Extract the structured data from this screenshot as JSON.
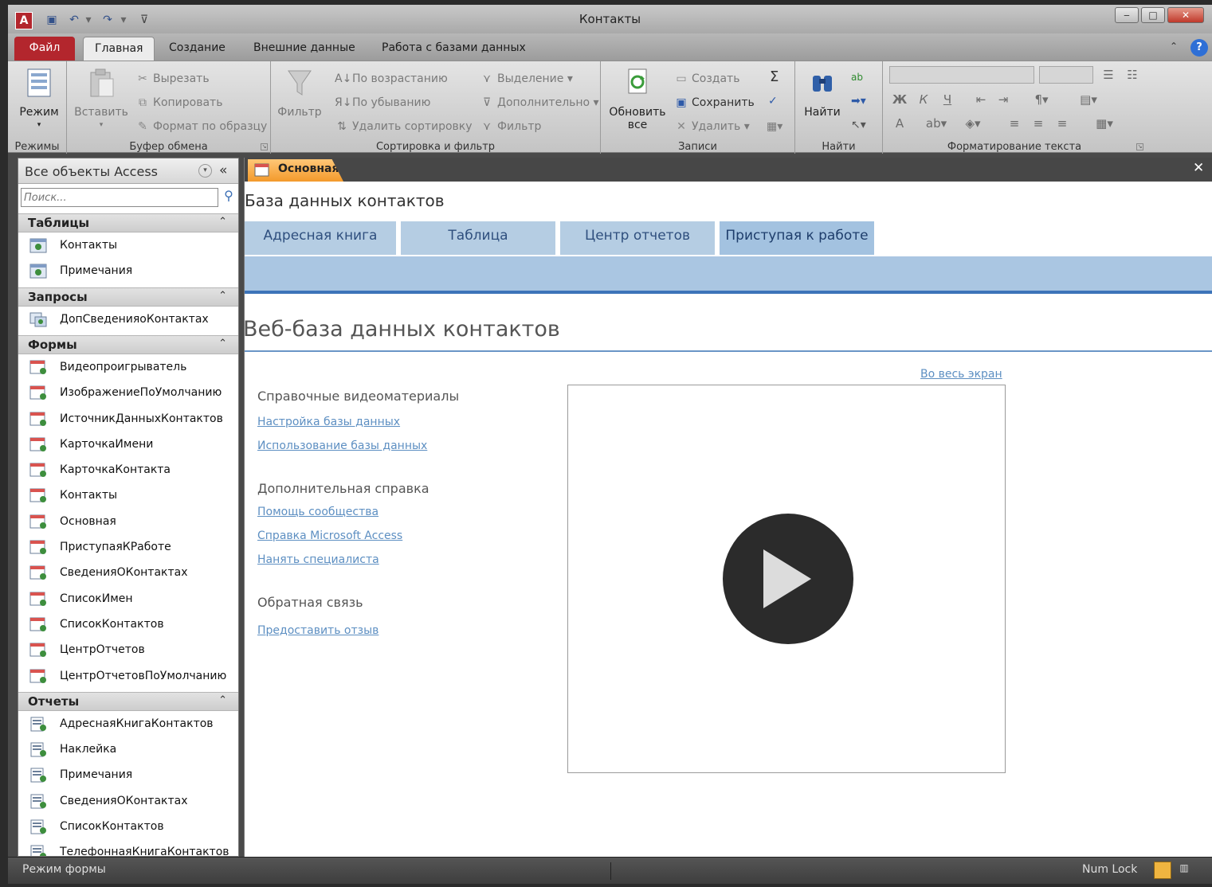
{
  "window": {
    "title": "Контакты",
    "app_icon_letter": "A"
  },
  "ribbon_tabs": [
    "Файл",
    "Главная",
    "Создание",
    "Внешние данные",
    "Работа с базами данных"
  ],
  "ribbon": {
    "views": {
      "mode": "Режим",
      "label": "Режимы"
    },
    "clipboard": {
      "paste": "Вставить",
      "cut": "Вырезать",
      "copy": "Копировать",
      "format_painter": "Формат по образцу",
      "label": "Буфер обмена"
    },
    "sort_filter": {
      "filter": "Фильтр",
      "ascending": "По возрастанию",
      "descending": "По убыванию",
      "remove_sort": "Удалить сортировку",
      "selection": "Выделение",
      "advanced": "Дополнительно",
      "toggle_filter": "Фильтр",
      "label": "Сортировка и фильтр"
    },
    "records": {
      "refresh_line1": "Обновить",
      "refresh_line2": "все",
      "new": "Создать",
      "save": "Сохранить",
      "delete": "Удалить",
      "totals_icon": "Σ",
      "label": "Записи"
    },
    "find": {
      "find": "Найти",
      "label": "Найти"
    },
    "text_format": {
      "bold": "Ж",
      "italic": "К",
      "underline": "Ч",
      "font_color": "А",
      "label": "Форматирование текста"
    }
  },
  "nav": {
    "title": "Все объекты Access",
    "collapse": "«",
    "search_placeholder": "Поиск...",
    "sections": [
      {
        "label": "Таблицы",
        "items": [
          "Контакты",
          "Примечания"
        ]
      },
      {
        "label": "Запросы",
        "items": [
          "ДопСведенияоКонтактах"
        ]
      },
      {
        "label": "Формы",
        "items": [
          "Видеопроигрыватель",
          "ИзображениеПоУмолчанию",
          "ИсточникДанныхКонтактов",
          "КарточкаИмени",
          "КарточкаКонтакта",
          "Контакты",
          "Основная",
          "ПриступаяКРаботе",
          "СведенияОКонтактах",
          "СписокИмен",
          "СписокКонтактов",
          "ЦентрОтчетов",
          "ЦентрОтчетовПоУмолчанию"
        ]
      },
      {
        "label": "Отчеты",
        "items": [
          "АдреснаяКнигаКонтактов",
          "Наклейка",
          "Примечания",
          "СведенияОКонтактах",
          "СписокКонтактов",
          "ТелефоннаяКнигаКонтактов"
        ]
      }
    ]
  },
  "document": {
    "tab_label": "Основная",
    "close": "✕",
    "form_title": "База данных контактов",
    "tabs": [
      "Адресная книга",
      "Таблица",
      "Центр отчетов",
      "Приступая к работе"
    ],
    "active_tab": 3,
    "heading": "Веб-база данных контактов",
    "fullscreen_link": "Во весь экран",
    "help_video_heading": "Справочные видеоматериалы",
    "help_video_links": [
      "Настройка базы данных",
      "Использование базы данных"
    ],
    "more_help_heading": "Дополнительная справка",
    "more_help_links": [
      "Помощь сообщества",
      "Справка Microsoft Access",
      "Нанять специалиста"
    ],
    "feedback_heading": "Обратная связь",
    "feedback_link": "Предоставить отзыв"
  },
  "status": {
    "mode": "Режим формы",
    "numlock": "Num Lock"
  },
  "colors": {
    "file_tab": "#b3262d",
    "doc_tab": "#f39a2b",
    "form_tab": "#b5cde3",
    "link": "#5d8fc2"
  }
}
